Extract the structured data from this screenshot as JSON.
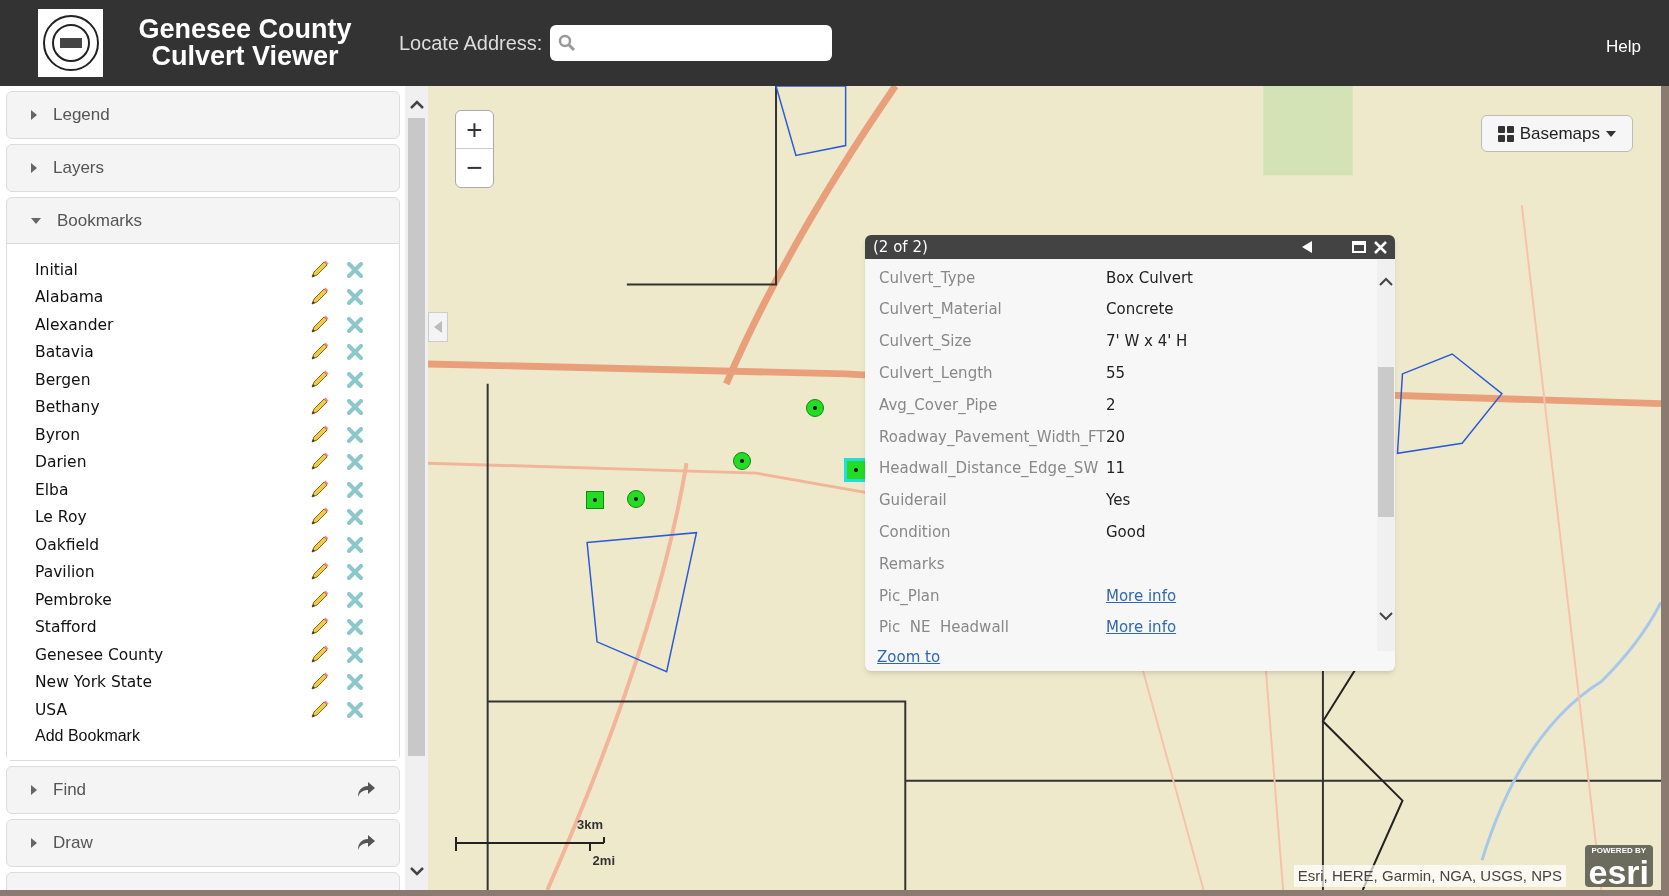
{
  "header": {
    "title_lines": [
      "Genesee County",
      "Culvert Viewer"
    ],
    "locate_label": "Locate Address:",
    "help": "Help"
  },
  "sidebar": {
    "panels": [
      {
        "title": "Legend",
        "expanded": false,
        "has_action": false
      },
      {
        "title": "Layers",
        "expanded": false,
        "has_action": false
      },
      {
        "title": "Bookmarks",
        "expanded": true,
        "has_action": false,
        "bookmarks": [
          "Initial",
          "Alabama",
          "Alexander",
          "Batavia",
          "Bergen",
          "Bethany",
          "Byron",
          "Darien",
          "Elba",
          "Le Roy",
          "Oakfield",
          "Pavilion",
          "Pembroke",
          "Stafford",
          "Genesee County",
          "New York State",
          "USA"
        ],
        "add_label": "Add Bookmark"
      },
      {
        "title": "Find",
        "expanded": false,
        "has_action": true
      },
      {
        "title": "Draw",
        "expanded": false,
        "has_action": true
      }
    ]
  },
  "map": {
    "zoom_in": "+",
    "zoom_out": "−",
    "basemaps": "Basemaps",
    "scale": {
      "km": "3km",
      "mi": "2mi"
    },
    "attribution": "Esri, HERE, Garmin, NGA, USGS, NPS",
    "powered_by": "POWERED BY",
    "esri": "esri",
    "markers": [
      {
        "kind": "dot",
        "selected": false
      },
      {
        "kind": "dot",
        "selected": false
      },
      {
        "kind": "dot",
        "selected": false
      },
      {
        "kind": "square",
        "selected": false
      },
      {
        "kind": "square",
        "selected": true
      }
    ]
  },
  "popup": {
    "title": "(2 of 2)",
    "fields": [
      {
        "name": "Culvert_Type",
        "value": "Box Culvert",
        "link": false
      },
      {
        "name": "Culvert_Material",
        "value": "Concrete",
        "link": false
      },
      {
        "name": "Culvert_Size",
        "value": "7' W x 4' H",
        "link": false
      },
      {
        "name": "Culvert_Length",
        "value": "55",
        "link": false
      },
      {
        "name": "Avg_Cover_Pipe",
        "value": "2",
        "link": false
      },
      {
        "name": "Roadway_Pavement_Width_FT",
        "value": "20",
        "link": false
      },
      {
        "name": "Headwall_Distance_Edge_SW",
        "value": "11",
        "link": false
      },
      {
        "name": "Guiderail",
        "value": "Yes",
        "link": false
      },
      {
        "name": "Condition",
        "value": "Good",
        "link": false
      },
      {
        "name": "Remarks"
      },
      {
        "name": "Pic_Plan",
        "value": "More info",
        "link": true
      },
      {
        "name": "Pic  NE  Headwall",
        "value": "More info",
        "link": true
      }
    ],
    "zoom_to": "Zoom to"
  }
}
